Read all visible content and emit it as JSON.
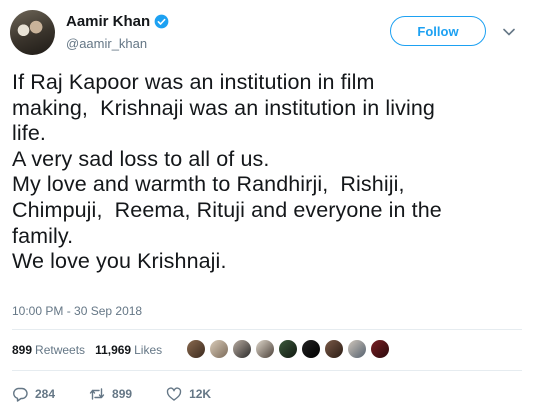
{
  "author": {
    "name": "Aamir Khan",
    "handle": "@aamir_khan"
  },
  "follow_label": "Follow",
  "tweet_lines": [
    "If Raj Kapoor was an institution in film",
    "making,  Krishnaji was an institution in living",
    "life.",
    "A very sad loss to all of us.",
    "My love and warmth to Randhirji,  Rishiji,",
    "Chimpuji,  Reema, Rituji and everyone in the",
    "family.",
    "We love you Krishnaji."
  ],
  "timestamp": "10:00 PM - 30 Sep 2018",
  "stats": {
    "retweets_count": "899",
    "retweets_label": "Retweets",
    "likes_count": "11,969",
    "likes_label": "Likes"
  },
  "actions": {
    "replies": "284",
    "retweets": "899",
    "likes": "12K"
  },
  "colors": {
    "accent": "#1da1f2",
    "text": "#14171a",
    "muted": "#657786"
  }
}
